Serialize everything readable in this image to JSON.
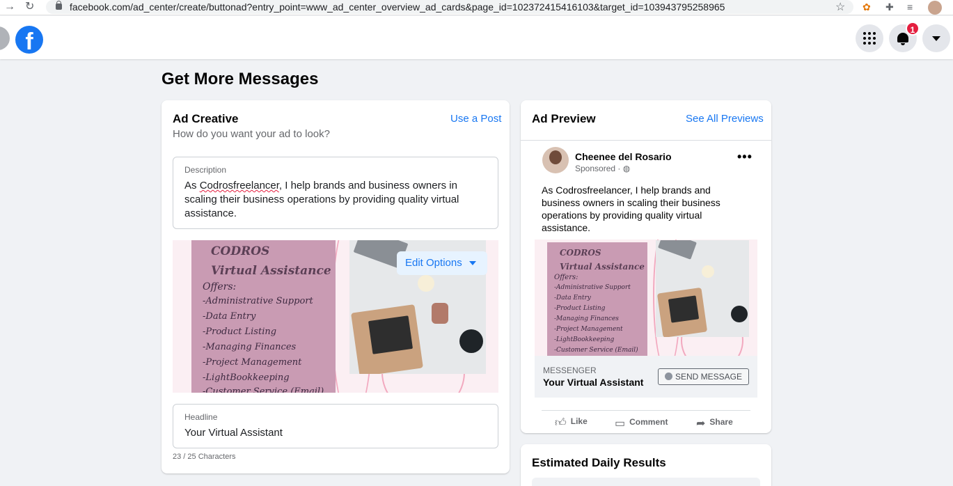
{
  "browser": {
    "url": "facebook.com/ad_center/create/buttonad?entry_point=www_ad_center_overview_ad_cards&page_id=102372415416103&target_id=103943795258965"
  },
  "topbar": {
    "logo": "f",
    "notifications_count": "1"
  },
  "page": {
    "title": "Get More Messages"
  },
  "ad_creative": {
    "title": "Ad Creative",
    "subtitle": "How do you want your ad to look?",
    "use_post_link": "Use a Post",
    "description_label": "Description",
    "description_word": "Codrosfreelancer",
    "description_before": "As ",
    "description_after": ", I help brands and business owners in scaling their business operations by providing quality virtual assistance.",
    "edit_options_label": "Edit Options",
    "headline_label": "Headline",
    "headline_value": "Your Virtual Assistant",
    "char_count": "23 / 25 Characters"
  },
  "creative_image": {
    "title_1": "CODROS",
    "title_2": "Virtual Assistance",
    "offers": "Offers:",
    "items": [
      "-Administrative Support",
      "-Data Entry",
      "-Product Listing",
      "-Managing Finances",
      "-Project Management",
      "-LightBookkeeping",
      "-Customer Service (Email)"
    ]
  },
  "ad_preview": {
    "title": "Ad Preview",
    "see_all_link": "See All Previews",
    "page_name": "Cheenee del Rosario",
    "sponsored": "Sponsored · ",
    "more": "•••",
    "body_text": "As Codrosfreelancer, I help brands and business owners in scaling their business operations by providing quality virtual assistance.",
    "cta_label": "MESSENGER",
    "cta_title": "Your Virtual Assistant",
    "cta_button": "SEND MESSAGE",
    "actions": {
      "like": "Like",
      "comment": "Comment",
      "share": "Share"
    }
  },
  "estimated": {
    "title": "Estimated Daily Results"
  }
}
